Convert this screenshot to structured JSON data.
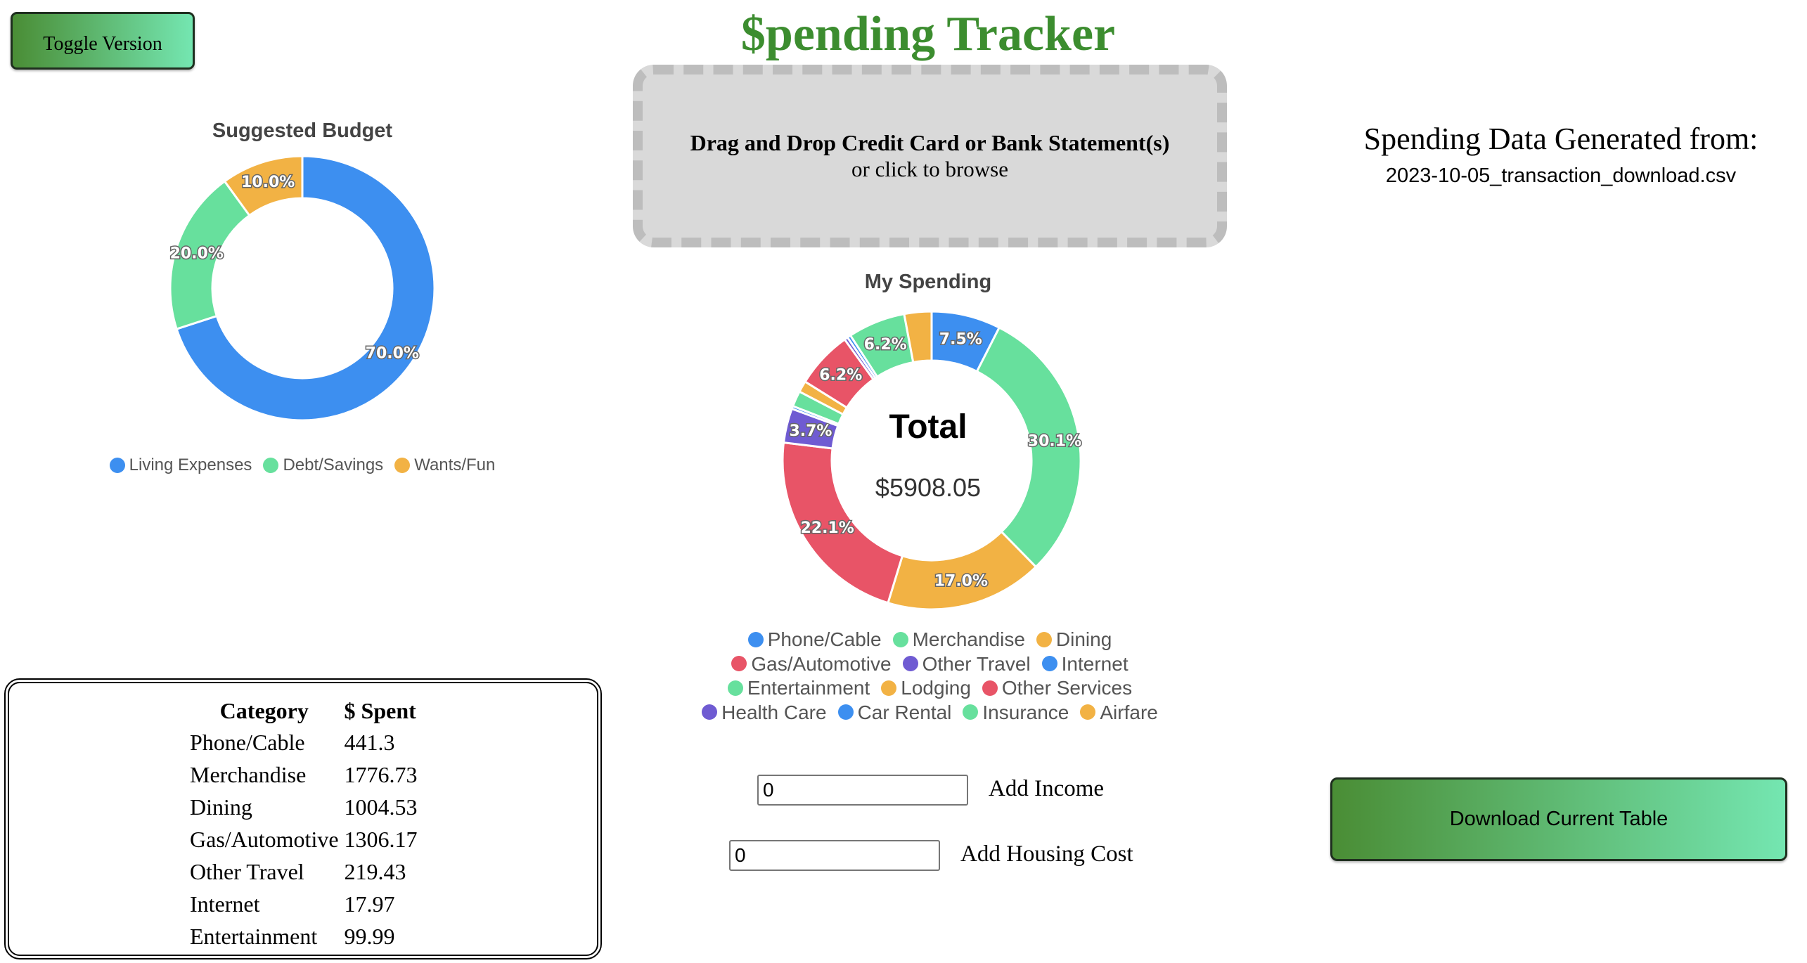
{
  "app": {
    "title": "$pending Tracker",
    "toggle_label": "Toggle Version"
  },
  "dropzone": {
    "line1": "Drag and Drop Credit Card or Bank Statement(s)",
    "line2": "or click to browse"
  },
  "source": {
    "title": "Spending Data Generated from:",
    "filename": "2023-10-05_transaction_download.csv"
  },
  "budget_chart": {
    "title": "Suggested Budget",
    "legend": [
      {
        "label": "Living Expenses",
        "color": "#3d8ff0"
      },
      {
        "label": "Debt/Savings",
        "color": "#67e09d"
      },
      {
        "label": "Wants/Fun",
        "color": "#f2b244"
      }
    ]
  },
  "spending_chart": {
    "title": "My Spending",
    "total_label": "Total",
    "total_value": "$5908.05",
    "legend_rows": [
      [
        {
          "label": "Phone/Cable",
          "color": "#3d8ff0"
        },
        {
          "label": "Merchandise",
          "color": "#67e09d"
        },
        {
          "label": "Dining",
          "color": "#f2b244"
        }
      ],
      [
        {
          "label": "Gas/Automotive",
          "color": "#e85467"
        },
        {
          "label": "Other Travel",
          "color": "#6f5bd2"
        },
        {
          "label": "Internet",
          "color": "#3d8ff0"
        }
      ],
      [
        {
          "label": "Entertainment",
          "color": "#67e09d"
        },
        {
          "label": "Lodging",
          "color": "#f2b244"
        },
        {
          "label": "Other Services",
          "color": "#e85467"
        }
      ],
      [
        {
          "label": "Health Care",
          "color": "#6f5bd2"
        },
        {
          "label": "Car Rental",
          "color": "#3d8ff0"
        },
        {
          "label": "Insurance",
          "color": "#67e09d"
        },
        {
          "label": "Airfare",
          "color": "#f2b244"
        }
      ]
    ]
  },
  "chart_data": [
    {
      "type": "pie",
      "title": "Suggested Budget",
      "categories": [
        "Living Expenses",
        "Debt/Savings",
        "Wants/Fun"
      ],
      "values": [
        70.0,
        20.0,
        10.0
      ],
      "labels": [
        "70.0%",
        "20.0%",
        "10.0%"
      ],
      "colors": [
        "#3d8ff0",
        "#67e09d",
        "#f2b244"
      ],
      "legend": "bottom"
    },
    {
      "type": "pie",
      "title": "My Spending",
      "categories": [
        "Phone/Cable",
        "Merchandise",
        "Dining",
        "Gas/Automotive",
        "Other Travel",
        "Internet",
        "Entertainment",
        "Lodging",
        "Other Services",
        "Health Care",
        "Car Rental",
        "Insurance",
        "Airfare"
      ],
      "values": [
        441.3,
        1776.73,
        1004.53,
        1306.17,
        219.43,
        17.97,
        99.99,
        72.0,
        366.0,
        22.0,
        22.0,
        366.0,
        174.0
      ],
      "labels": [
        "7.5%",
        "30.1%",
        "17.0%",
        "22.1%",
        "3.7%",
        "",
        "",
        "",
        "6.2%",
        "",
        "",
        "6.2%",
        ""
      ],
      "colors": [
        "#3d8ff0",
        "#67e09d",
        "#f2b244",
        "#e85467",
        "#6f5bd2",
        "#3d8ff0",
        "#67e09d",
        "#f2b244",
        "#e85467",
        "#6f5bd2",
        "#3d8ff0",
        "#67e09d",
        "#f2b244"
      ],
      "legend": "bottom"
    }
  ],
  "inputs": {
    "income_value": "0",
    "income_label": "Add Income",
    "housing_value": "0",
    "housing_label": "Add Housing Cost"
  },
  "download_label": "Download Current Table",
  "table": {
    "headers": [
      "Category",
      "$ Spent"
    ],
    "rows": [
      [
        "Phone/Cable",
        "441.3"
      ],
      [
        "Merchandise",
        "1776.73"
      ],
      [
        "Dining",
        "1004.53"
      ],
      [
        "Gas/Automotive",
        "1306.17"
      ],
      [
        "Other Travel",
        "219.43"
      ],
      [
        "Internet",
        "17.97"
      ],
      [
        "Entertainment",
        "99.99"
      ]
    ]
  }
}
